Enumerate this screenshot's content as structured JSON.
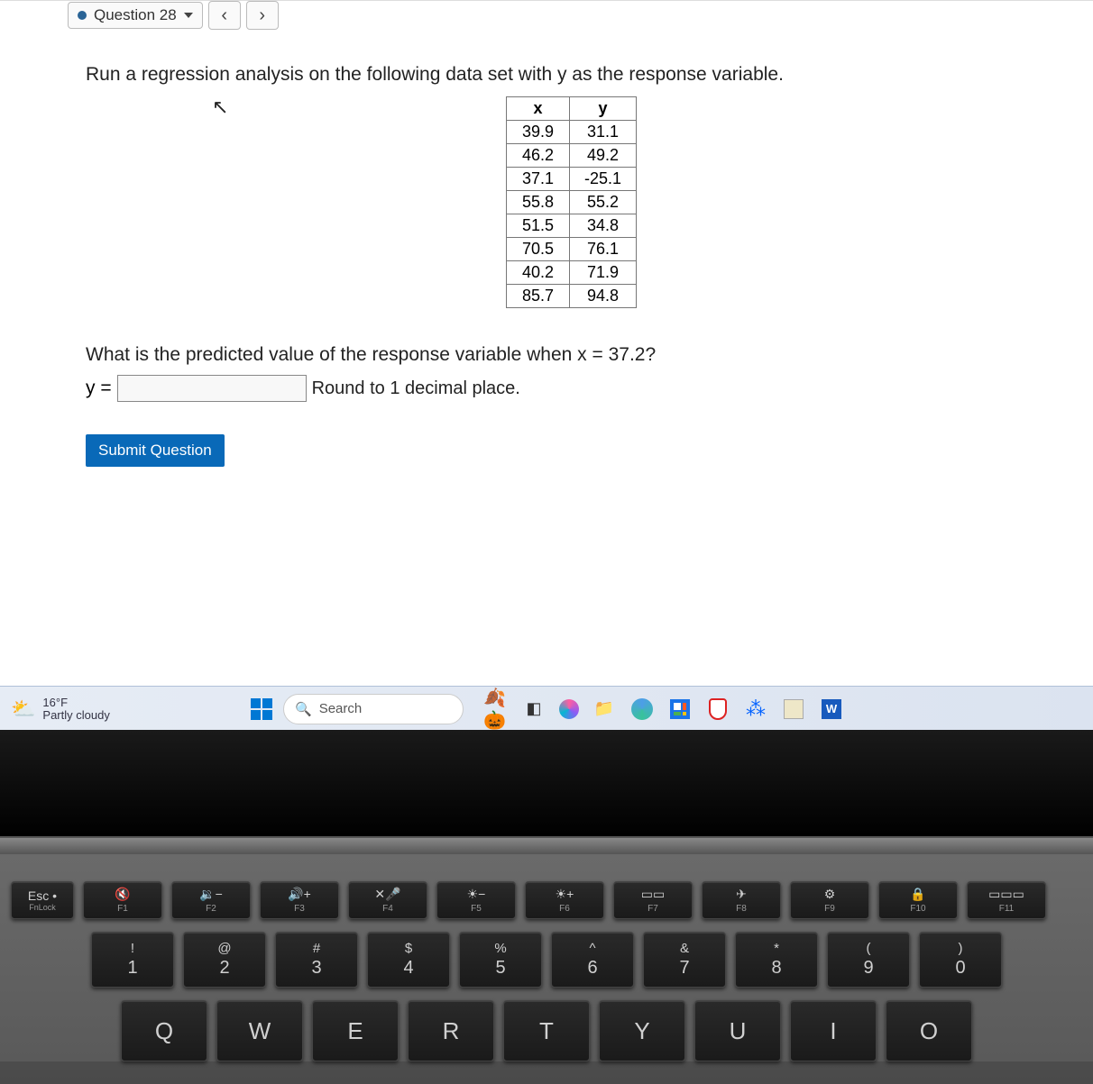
{
  "nav": {
    "question_label": "Question 28",
    "prev_symbol": "‹",
    "next_symbol": "›"
  },
  "problem": {
    "prompt": "Run a regression analysis on the following data set with y as the response variable.",
    "table": {
      "headers": [
        "x",
        "y"
      ],
      "rows": [
        [
          "39.9",
          "31.1"
        ],
        [
          "46.2",
          "49.2"
        ],
        [
          "37.1",
          "-25.1"
        ],
        [
          "55.8",
          "55.2"
        ],
        [
          "51.5",
          "34.8"
        ],
        [
          "70.5",
          "76.1"
        ],
        [
          "40.2",
          "71.9"
        ],
        [
          "85.7",
          "94.8"
        ]
      ]
    },
    "question": "What is the predicted value of the response variable when x = 37.2?",
    "answer_label": "y =",
    "answer_value": "",
    "round_note": "Round to 1 decimal place.",
    "submit_label": "Submit Question"
  },
  "taskbar": {
    "weather": {
      "temp": "16°F",
      "desc": "Partly cloudy"
    },
    "search_placeholder": "Search"
  },
  "keyboard": {
    "esc_top": "Esc",
    "esc_bot": "FnLock",
    "esc_dot": "•",
    "fn_row": [
      {
        "sym": "🔇",
        "lbl": "F1"
      },
      {
        "sym": "🔉−",
        "lbl": "F2"
      },
      {
        "sym": "🔊+",
        "lbl": "F3"
      },
      {
        "sym": "✕🎤",
        "lbl": "F4"
      },
      {
        "sym": "☀−",
        "lbl": "F5"
      },
      {
        "sym": "☀+",
        "lbl": "F6"
      },
      {
        "sym": "▭▭",
        "lbl": "F7"
      },
      {
        "sym": "✈",
        "lbl": "F8"
      },
      {
        "sym": "⚙",
        "lbl": "F9"
      },
      {
        "sym": "🔒",
        "lbl": "F10"
      },
      {
        "sym": "▭▭▭",
        "lbl": "F11"
      }
    ],
    "num_row": [
      {
        "sym": "!",
        "num": "1"
      },
      {
        "sym": "@",
        "num": "2"
      },
      {
        "sym": "#",
        "num": "3"
      },
      {
        "sym": "$",
        "num": "4"
      },
      {
        "sym": "%",
        "num": "5"
      },
      {
        "sym": "^",
        "num": "6"
      },
      {
        "sym": "&",
        "num": "7"
      },
      {
        "sym": "*",
        "num": "8"
      },
      {
        "sym": "(",
        "num": "9"
      },
      {
        "sym": ")",
        "num": "0"
      }
    ],
    "letter_row": [
      "Q",
      "W",
      "E",
      "R",
      "T",
      "Y",
      "U",
      "I",
      "O"
    ]
  }
}
